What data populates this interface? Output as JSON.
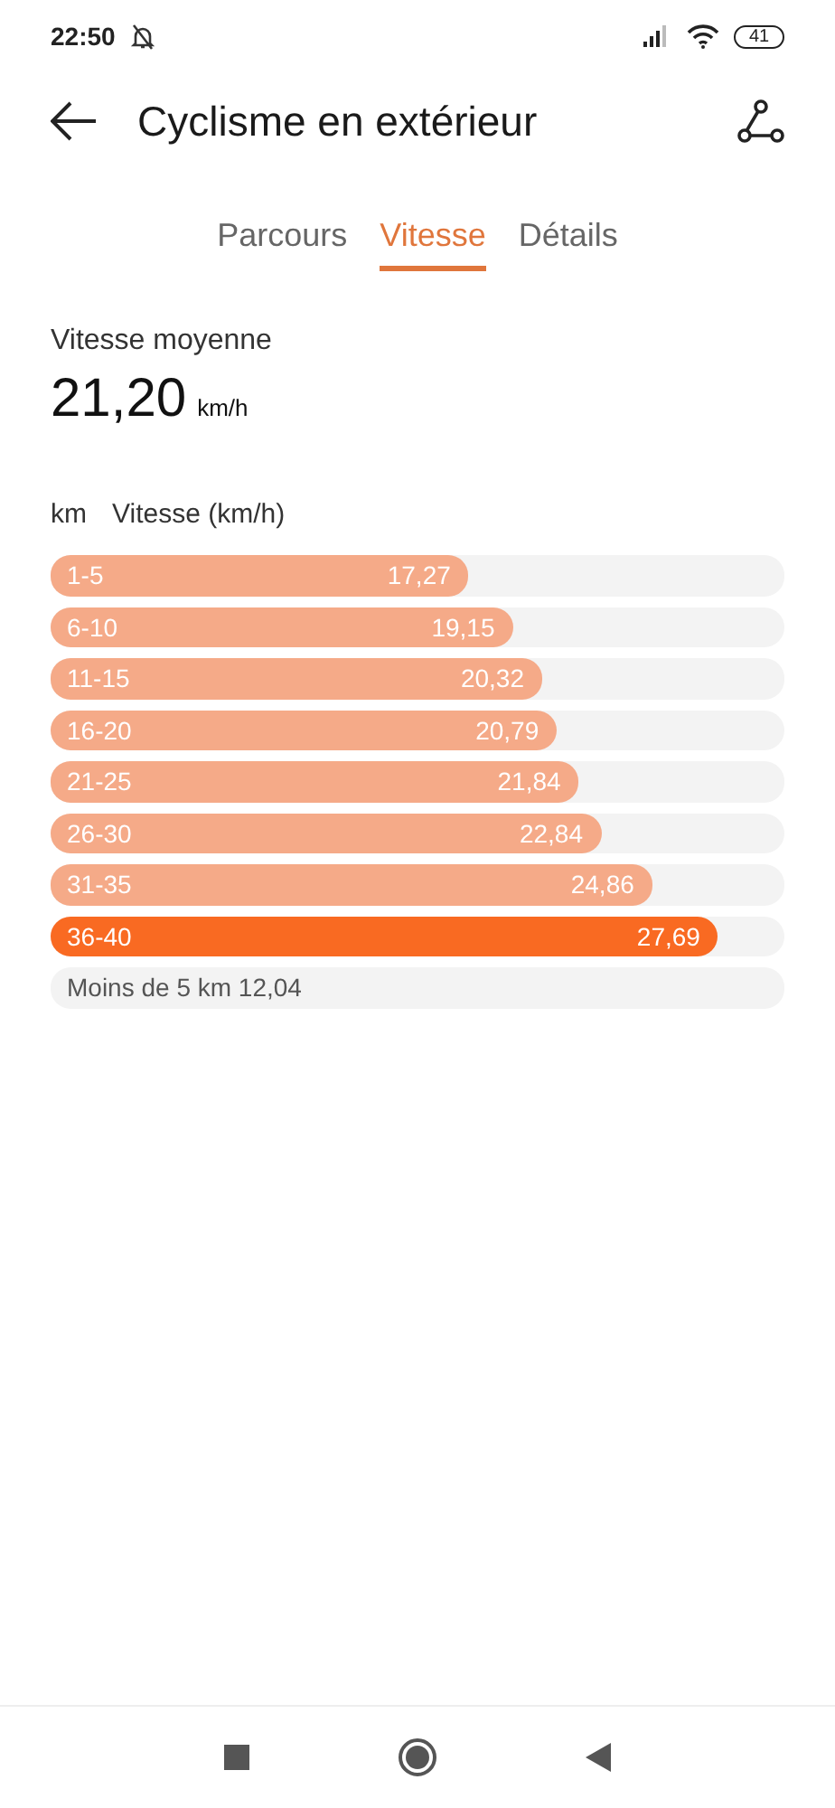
{
  "status_bar": {
    "time": "22:50",
    "battery": "41"
  },
  "header": {
    "title": "Cyclisme en extérieur"
  },
  "tabs": [
    {
      "label": "Parcours",
      "selected": false
    },
    {
      "label": "Vitesse",
      "selected": true
    },
    {
      "label": "Détails",
      "selected": false
    }
  ],
  "average": {
    "label": "Vitesse moyenne",
    "value": "21,20",
    "unit": "km/h"
  },
  "table": {
    "columns": [
      "km",
      "Vitesse (km/h)"
    ],
    "rows": [
      {
        "range": "1-5",
        "speed": "17,27",
        "level": 0.57,
        "best": false
      },
      {
        "range": "6-10",
        "speed": "19,15",
        "level": 0.63,
        "best": false
      },
      {
        "range": "11-15",
        "speed": "20,32",
        "level": 0.67,
        "best": false
      },
      {
        "range": "16-20",
        "speed": "20,79",
        "level": 0.69,
        "best": false
      },
      {
        "range": "21-25",
        "speed": "21,84",
        "level": 0.72,
        "best": false
      },
      {
        "range": "26-30",
        "speed": "22,84",
        "level": 0.75,
        "best": false
      },
      {
        "range": "31-35",
        "speed": "24,86",
        "level": 0.82,
        "best": false
      },
      {
        "range": "36-40",
        "speed": "27,69",
        "level": 0.91,
        "best": true
      }
    ],
    "footer": "Moins de 5 km 12,04"
  }
}
